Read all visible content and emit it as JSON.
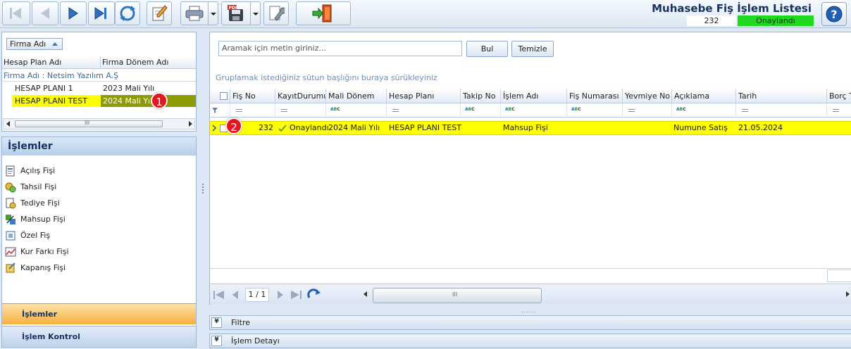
{
  "toolbar": {
    "buttons": [
      "first-record-icon",
      "previous-record-icon",
      "next-record-icon",
      "last-record-icon",
      "refresh-icon",
      "edit-icon",
      "print-icon",
      "pdf-export-icon",
      "settings-wrench-icon",
      "exit-door-icon"
    ]
  },
  "header": {
    "title": "Muhasebe Fiş İşlem Listesi",
    "fis_no": "232",
    "status": "Onaylandı",
    "status_color": "#1fd91f"
  },
  "firm_panel": {
    "group_chip": "Firma Adı",
    "columns": [
      "Hesap Plan Adı",
      "Firma Dönem Adı"
    ],
    "group_row": "Firma Adı : Netsim Yazılım A.Ş",
    "rows": [
      {
        "plan": "HESAP PLANI 1",
        "period": "2023 Mali Yılı"
      },
      {
        "plan": "HESAP PLANI TEST",
        "period": "2024 Mali Yılı"
      }
    ],
    "selected_row_color": "#fefe04",
    "badge": "1",
    "scroll_grip": "III"
  },
  "nav": {
    "header": "İşlemler",
    "items": [
      {
        "label": "Açılış Fişi",
        "icon": "opening-voucher-icon"
      },
      {
        "label": "Tahsil Fişi",
        "icon": "collection-voucher-icon"
      },
      {
        "label": "Tediye Fişi",
        "icon": "payment-voucher-icon"
      },
      {
        "label": "Mahsup Fişi",
        "icon": "offset-voucher-icon"
      },
      {
        "label": "Özel Fiş",
        "icon": "special-voucher-icon"
      },
      {
        "label": "Kur Farkı Fişi",
        "icon": "exchange-diff-voucher-icon"
      },
      {
        "label": "Kapanış Fişi",
        "icon": "closing-voucher-icon"
      }
    ],
    "bottom_tabs": [
      "İşlemler",
      "İşlem Kontrol"
    ]
  },
  "search": {
    "placeholder": "Aramak için metin giriniz...",
    "find_label": "Bul",
    "clear_label": "Temizle"
  },
  "grid": {
    "group_hint": "Gruplamak istediğiniz sütun başlığını buraya sürükleyiniz",
    "columns": [
      "Fiş No",
      "KayıtDurumu",
      "Mali Dönem",
      "Hesap Planı",
      "Takip No",
      "İşlem Adı",
      "Fiş Numarası",
      "Yevmiye No",
      "Açıklama",
      "Tarih",
      "Borç To"
    ],
    "rows": [
      {
        "fis_no": "232",
        "kayit_durumu": "Onaylandı",
        "mali_donem": "2024 Mali Yılı",
        "hesap_plani": "HESAP PLANI TEST",
        "takip_no": "",
        "islem_adi": "Mahsup Fişi",
        "fis_numarasi": "",
        "yevmiye_no": "",
        "aciklama": "Numune Satış",
        "tarih": "21.05.2024",
        "borc": ""
      }
    ],
    "badge": "2",
    "abc_marker": [
      "A",
      "B",
      "C"
    ],
    "page_indicator": "1 / 1",
    "scroll_grip": "III"
  },
  "panels": {
    "filter_label": "Filtre",
    "detail_label": "İşlem Detayı",
    "splitter_grip": "......"
  }
}
